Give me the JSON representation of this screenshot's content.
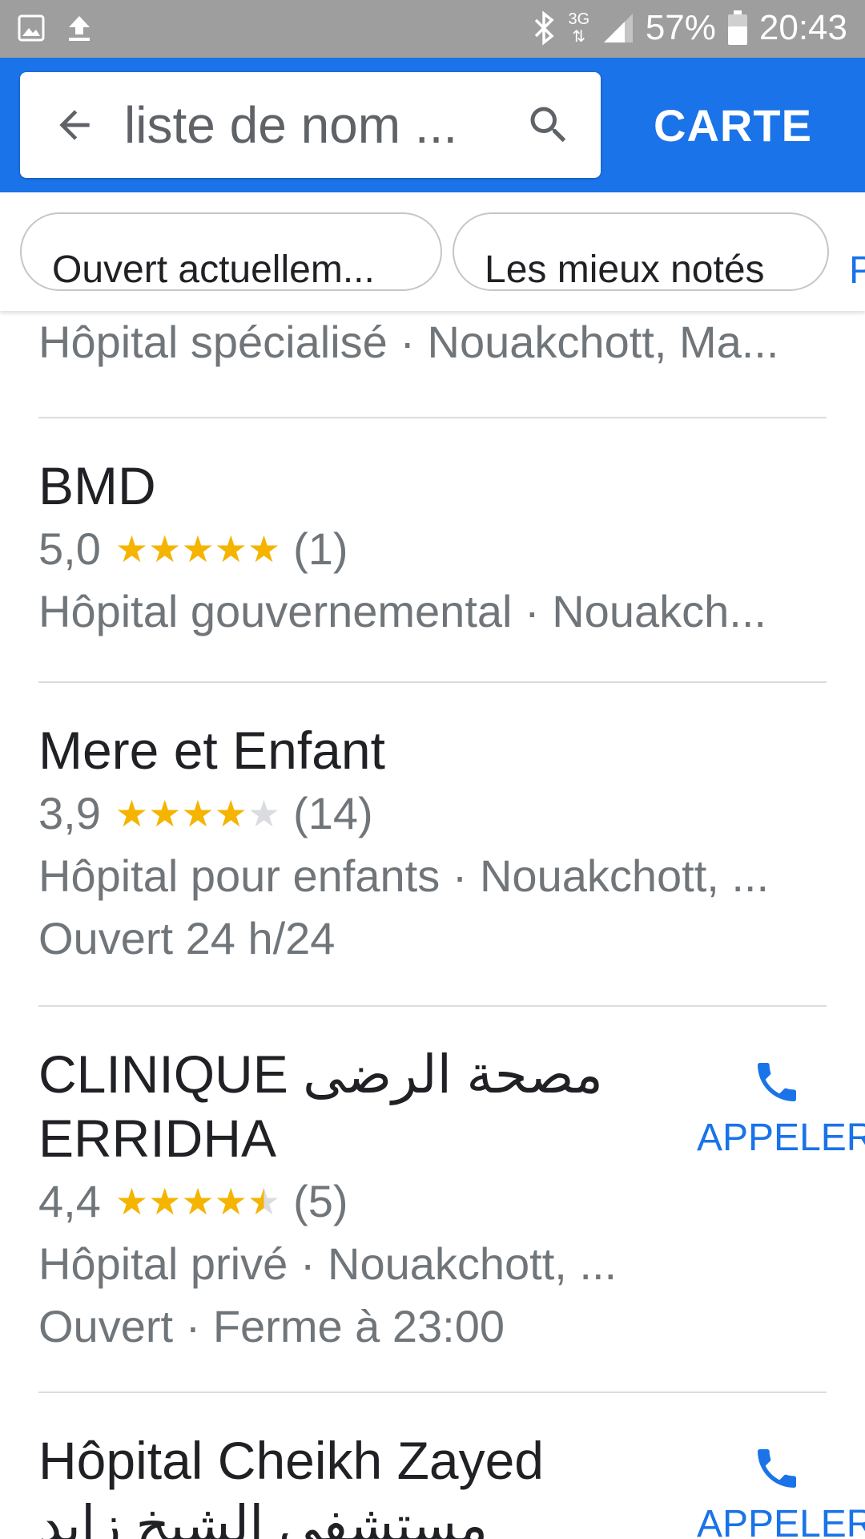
{
  "status_bar": {
    "left_icons": [
      "image-icon",
      "upload-icon"
    ],
    "right_icons": [
      "bluetooth-icon",
      "network-3g-icon",
      "signal-icon",
      "battery-icon"
    ],
    "network_label": "3G",
    "battery": "57%",
    "time": "20:43"
  },
  "header": {
    "search_text": "liste de nom ...",
    "map_label": "CARTE",
    "back_icon": "arrow-back-icon",
    "search_icon": "search-icon",
    "color": "#1a73e8"
  },
  "chips": [
    {
      "label": "Ouvert actuellem..."
    },
    {
      "label": "Les mieux notés"
    },
    {
      "label": "P"
    }
  ],
  "results": [
    {
      "subtitle": "Hôpital spécialisé · Nouakchott, Ma..."
    },
    {
      "name": "BMD",
      "rating": "5,0",
      "rating_value": 5.0,
      "reviews": "(1)",
      "category": "Hôpital gouvernemental · Nouakch..."
    },
    {
      "name": "Mere et Enfant",
      "rating": "3,9",
      "rating_value": 3.9,
      "reviews": "(14)",
      "category": "Hôpital pour enfants · Nouakchott, ...",
      "hours": "Ouvert 24 h/24"
    },
    {
      "name_line1": "CLINIQUE مصحة الرضى",
      "name_line2": "ERRIDHA",
      "rating": "4,4",
      "rating_value": 4.4,
      "reviews": "(5)",
      "category": "Hôpital privé · Nouakchott, ...",
      "hours": "Ouvert  ·  Ferme à 23:00",
      "call_label": "APPELER"
    },
    {
      "name_line1": "Hôpital Cheikh Zayed",
      "name_line2": "مستشفى الشيخ زايد",
      "call_label": "APPELER"
    }
  ],
  "colors": {
    "accent": "#1a73e8",
    "star": "#f4b400",
    "star_empty": "#dadce0",
    "secondary_text": "#70757a"
  }
}
